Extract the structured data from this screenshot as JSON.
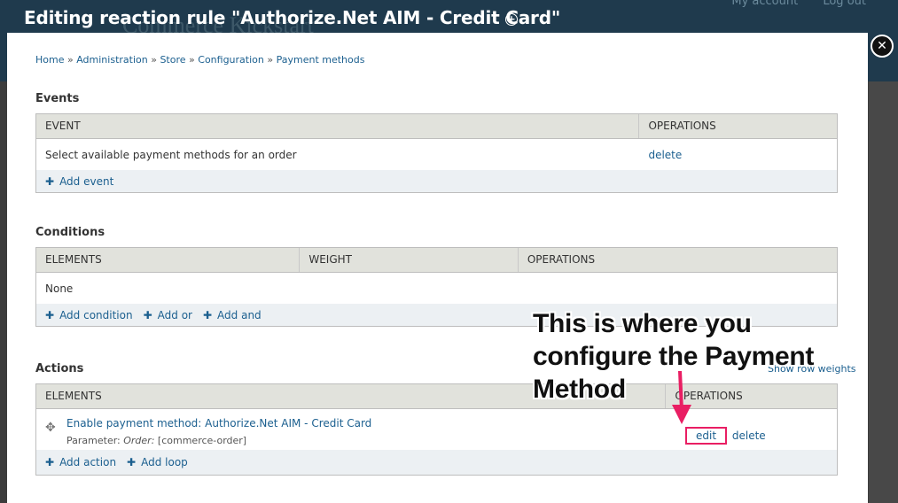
{
  "background": {
    "site_name": "Commerce Kickstart",
    "links": [
      "My account",
      "Log out"
    ]
  },
  "overlay": {
    "title": "Editing reaction rule \"Authorize.Net AIM - Credit Card\""
  },
  "breadcrumb": [
    "Home",
    "Administration",
    "Store",
    "Configuration",
    "Payment methods"
  ],
  "events": {
    "title": "Events",
    "headers": [
      "EVENT",
      "OPERATIONS"
    ],
    "rows": [
      {
        "event": "Select available payment methods for an order",
        "op": "delete"
      }
    ],
    "add_links": [
      "Add event"
    ]
  },
  "conditions": {
    "title": "Conditions",
    "headers": [
      "ELEMENTS",
      "WEIGHT",
      "OPERATIONS"
    ],
    "rows": [
      {
        "element": "None"
      }
    ],
    "add_links": [
      "Add condition",
      "Add or",
      "Add and"
    ]
  },
  "actions": {
    "title": "Actions",
    "show_weights": "Show row weights",
    "headers": [
      "ELEMENTS",
      "OPERATIONS"
    ],
    "rows": [
      {
        "title": "Enable payment method: Authorize.Net AIM - Credit Card",
        "param_label": "Parameter:",
        "param_name": "Order:",
        "param_value": "[commerce-order]",
        "edit": "edit",
        "delete": "delete"
      }
    ],
    "add_links": [
      "Add action",
      "Add loop"
    ]
  },
  "annotation": {
    "lines": [
      "This is where you",
      "configure the Payment",
      "Method"
    ],
    "color": "#e91e63"
  }
}
